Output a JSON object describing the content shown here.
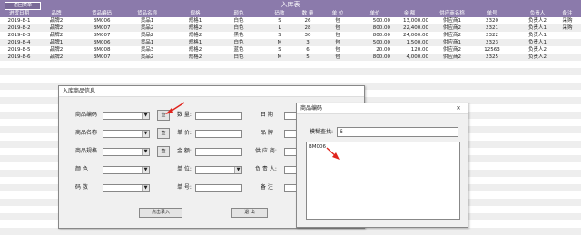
{
  "sheet": {
    "back_label": "返回菜单",
    "title": "入库表",
    "columns": [
      "进货日期",
      "品牌",
      "货品编码",
      "货品名称",
      "规格",
      "颜色",
      "码数",
      "数 量",
      "单 位",
      "单价",
      "金 额",
      "供应商名称",
      "单号",
      "负责人",
      "备注"
    ],
    "rows": [
      [
        "2019-8-1",
        "品牌2",
        "BM006",
        "货品1",
        "规格1",
        "白色",
        "S",
        "26",
        "包",
        "500.00",
        "13,000.00",
        "供应商1",
        "2320",
        "负责人2",
        "采购"
      ],
      [
        "2019-8-2",
        "品牌2",
        "BM007",
        "货品2",
        "规格2",
        "白色",
        "L",
        "28",
        "包",
        "800.00",
        "22,400.00",
        "供应商2",
        "2321",
        "负责人1",
        "采购"
      ],
      [
        "2019-8-3",
        "品牌2",
        "BM007",
        "货品2",
        "规格2",
        "黑色",
        "S",
        "30",
        "包",
        "800.00",
        "24,000.00",
        "供应商2",
        "2322",
        "负责人1",
        ""
      ],
      [
        "2019-8-4",
        "品牌1",
        "BM006",
        "货品1",
        "规格1",
        "白色",
        "M",
        "3",
        "包",
        "500.00",
        "1,500.00",
        "供应商1",
        "2323",
        "负责人1",
        ""
      ],
      [
        "2019-8-5",
        "品牌2",
        "BM008",
        "货品3",
        "规格2",
        "蓝色",
        "S",
        "6",
        "包",
        "20.00",
        "120.00",
        "供应商2",
        "12563",
        "负责人2",
        ""
      ],
      [
        "2019-8-6",
        "品牌2",
        "BM007",
        "货品2",
        "规格2",
        "白色",
        "M",
        "5",
        "包",
        "800.00",
        "4,000.00",
        "供应商2",
        "2325",
        "负责人2",
        ""
      ]
    ]
  },
  "entry_dialog": {
    "title": "入库商品信息",
    "labels": {
      "product_code": "商品编码",
      "product_name": "商品名称",
      "spec": "商品规格",
      "color": "颜    色",
      "size": "码    数",
      "quantity": "数 量:",
      "unit_price": "单 价:",
      "amount": "金 额:",
      "unit": "单 位:",
      "order_no": "单 号:",
      "date": "日    期",
      "brand": "品    牌",
      "supplier": "供 应 商:",
      "owner": "负 责 人:",
      "remarks": "备    注"
    },
    "search_button": "查",
    "add_button": "点击录入",
    "exit_button": "退  出"
  },
  "code_dialog": {
    "title": "商品编码",
    "search_label": "模糊查找:",
    "search_value": "6",
    "results": [
      "BM006"
    ],
    "close_glyph": "✕"
  },
  "colors": {
    "header_bg": "#8b7aab",
    "arrow": "#e0231c"
  }
}
